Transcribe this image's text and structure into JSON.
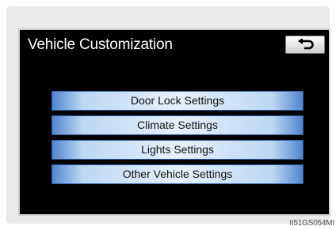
{
  "screen": {
    "title": "Vehicle Customization",
    "back_icon": "back-arrow-icon",
    "menu": [
      {
        "label": "Door Lock Settings"
      },
      {
        "label": "Climate Settings"
      },
      {
        "label": "Lights Settings"
      },
      {
        "label": "Other Vehicle Settings"
      }
    ]
  },
  "figure_code": "II51GS054MI",
  "colors": {
    "screen_background": "#000000",
    "button_accent": "#4f86cf",
    "button_highlight": "#e6f1fd"
  }
}
